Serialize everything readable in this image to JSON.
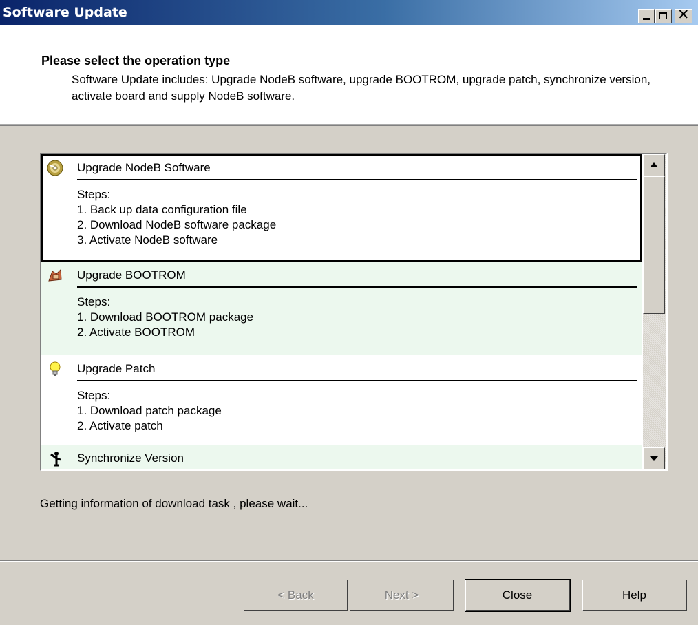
{
  "window": {
    "title": "Software Update",
    "controls": [
      "minimize-icon",
      "maximize-icon",
      "close-icon"
    ]
  },
  "header": {
    "heading": "Please select the operation type",
    "description": "Software Update includes: Upgrade NodeB software, upgrade BOOTROM, upgrade patch, synchronize version, activate board and supply NodeB software."
  },
  "operations": [
    {
      "name": "Upgrade NodeB Software",
      "icon": "disc-icon",
      "selected": true,
      "steps": [
        "Steps:",
        "1. Back up data configuration file",
        "2. Download NodeB software package",
        "3. Activate NodeB software"
      ]
    },
    {
      "name": "Upgrade BOOTROM",
      "icon": "bootrom-chip-icon",
      "selected": false,
      "steps": [
        "Steps:",
        "1. Download BOOTROM package",
        "2. Activate BOOTROM"
      ]
    },
    {
      "name": "Upgrade Patch",
      "icon": "lightbulb-icon",
      "selected": false,
      "steps": [
        "Steps:",
        "1. Download patch package",
        "2. Activate patch"
      ]
    },
    {
      "name": "Synchronize Version",
      "icon": "sync-person-icon",
      "selected": false,
      "steps": []
    }
  ],
  "status": "Getting information of download task , please wait...",
  "buttons": {
    "back": "< Back",
    "next": "Next >",
    "close": "Close",
    "help": "Help"
  },
  "colors": {
    "title_gradient_start": "#0a246a",
    "title_gradient_end": "#a6caf0",
    "alt_row": "#ecf8ee",
    "face": "#d4d0c8"
  }
}
